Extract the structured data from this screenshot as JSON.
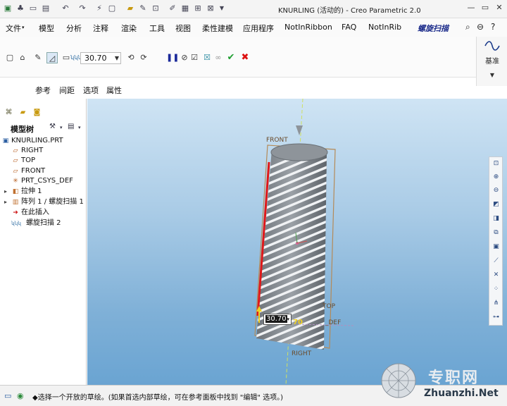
{
  "titlebar": {
    "title": "KNURLING (活动的) - Creo Parametric 2.0",
    "quick_access_icons": [
      "new-icon",
      "open-icon",
      "save-icon",
      "undo-icon",
      "redo-icon",
      "regenerate-icon",
      "windows-icon",
      "close-window-icon"
    ]
  },
  "menu": {
    "items": [
      "文件",
      "模型",
      "分析",
      "注释",
      "渲染",
      "工具",
      "视图",
      "柔性建模",
      "应用程序",
      "NotInRibbon",
      "FAQ",
      "NotInRib",
      "螺旋扫描"
    ]
  },
  "ribbon": {
    "value": "30.70",
    "datum_label": "基准"
  },
  "subtabs": [
    "参考",
    "间距",
    "选项",
    "属性"
  ],
  "tree": {
    "header": "模型树",
    "items": [
      {
        "label": "KNURLING.PRT",
        "icon": "part-icon"
      },
      {
        "label": "RIGHT",
        "icon": "datum-plane-icon"
      },
      {
        "label": "TOP",
        "icon": "datum-plane-icon"
      },
      {
        "label": "FRONT",
        "icon": "datum-plane-icon"
      },
      {
        "label": "PRT_CSYS_DEF",
        "icon": "csys-icon"
      },
      {
        "label": "拉伸 1",
        "icon": "extrude-icon"
      },
      {
        "label": "阵列 1 / 螺旋扫描 1",
        "icon": "pattern-icon"
      },
      {
        "label": "在此插入",
        "icon": "insert-here-icon"
      },
      {
        "label": "螺旋扫描 2",
        "icon": "helical-sweep-icon"
      }
    ]
  },
  "viewport": {
    "labels": {
      "front": "FRONT",
      "top": "TOP",
      "right": "RIGHT",
      "csys": "_DEF"
    },
    "dim_value": "30.70",
    "dim_label2": "70"
  },
  "status": {
    "message": "◆选择一个开放的草绘。(如果首选内部草绘，可在参考面板中找到 \"编辑\" 选项。)"
  },
  "watermark": {
    "cn": "专职网",
    "en": "Zhuanzhi.Net"
  }
}
